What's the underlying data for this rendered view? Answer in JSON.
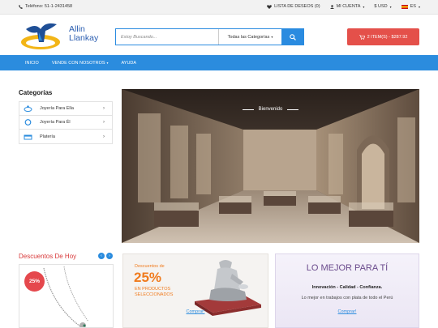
{
  "topbar": {
    "phone": "Teléfono: 51-1-2431458",
    "wishlist": "LISTA DE DESEOS (0)",
    "account": "MI CUENTA",
    "currency": "$ USD",
    "language": "ES"
  },
  "header": {
    "logo_line1": "Allin",
    "logo_line2": "Llankay",
    "search_placeholder": "Estoy Buscando...",
    "search_category": "Todas las Categorías",
    "cart_label": "2 ITEM(S) - $287.92"
  },
  "nav": {
    "items": [
      "INICIO",
      "VENDE CON NOSOTROS",
      "AYUDA"
    ]
  },
  "categories": {
    "title": "Categorías",
    "items": [
      "Joyería Para Ella",
      "Joyería Para Él",
      "Platería"
    ]
  },
  "hero": {
    "label": "Bienvenido"
  },
  "deals": {
    "title": "Descuentos De Hoy",
    "badge": "25%"
  },
  "promo1": {
    "small": "Descuentos de",
    "big": "25%",
    "sub_line1": "EN PRODUCTOS",
    "sub_line2": "SELECCIONADOS",
    "link": "Comprar!"
  },
  "promo2": {
    "title": "LO MEJOR PARA TÍ",
    "tagline": "Innovación - Calidad - Confianza.",
    "desc": "Lo mejor en trabajos con plata de todo el Perú",
    "link": "Comprar!"
  }
}
